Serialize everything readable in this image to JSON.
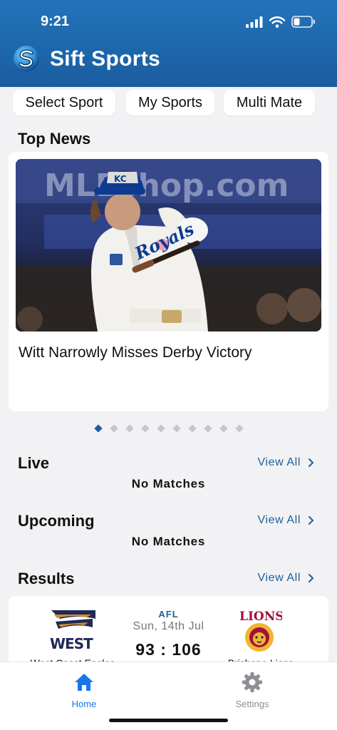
{
  "status_bar": {
    "time": "9:21"
  },
  "app": {
    "title": "Sift Sports"
  },
  "chips": [
    {
      "label": "Select Sport"
    },
    {
      "label": "My Sports"
    },
    {
      "label": "Multi Mate"
    }
  ],
  "top_news": {
    "title": "Top News",
    "headline": "Witt Narrowly Misses Derby Victory",
    "photo_banner_text": "MLBshop.com",
    "slide_count": 10,
    "active_slide": 1
  },
  "live": {
    "title": "Live",
    "view_all": "View All",
    "empty": "No Matches"
  },
  "upcoming": {
    "title": "Upcoming",
    "view_all": "View All",
    "empty": "No Matches"
  },
  "results": {
    "title": "Results",
    "view_all": "View All",
    "match": {
      "league": "AFL",
      "date": "Sun, 14th Jul",
      "score": "93 : 106",
      "home_team": "West Coast Eagles",
      "away_team": "Brisbane Lions"
    }
  },
  "tabs": [
    {
      "label": "Home",
      "icon": "home-icon",
      "active": true
    },
    {
      "label": "Settings",
      "icon": "gear-icon",
      "active": false
    }
  ],
  "colors": {
    "brand": "#1d66ab",
    "accent": "#1d5f9a",
    "tab_active": "#1877e8",
    "tab_inactive": "#8e8e93"
  }
}
